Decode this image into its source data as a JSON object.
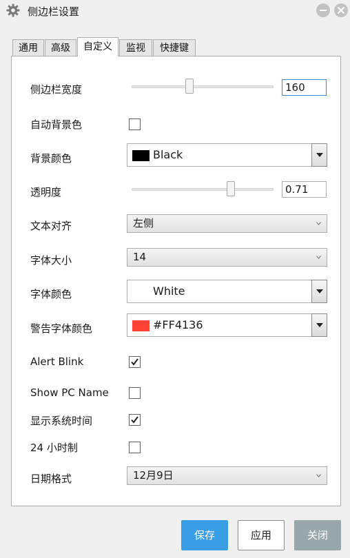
{
  "window": {
    "title": "侧边栏设置",
    "app_icon": "gear-icon",
    "minimize_icon": "minus-icon",
    "close_icon": "close-icon"
  },
  "tabs": [
    {
      "label": "通用",
      "active": false
    },
    {
      "label": "高级",
      "active": false
    },
    {
      "label": "自定义",
      "active": true
    },
    {
      "label": "监视",
      "active": false
    },
    {
      "label": "快捷键",
      "active": false
    }
  ],
  "settings": {
    "sidebar_width": {
      "label": "侧边栏宽度",
      "value": "160",
      "slider_fraction": 0.4
    },
    "auto_bg_color": {
      "label": "自动背景色",
      "checked": false
    },
    "bg_color": {
      "label": "背景颜色",
      "color_name": "Black",
      "swatch": "#000000"
    },
    "opacity": {
      "label": "透明度",
      "value": "0.71",
      "slider_fraction": 0.71
    },
    "text_align": {
      "label": "文本对齐",
      "value": "左侧"
    },
    "font_size": {
      "label": "字体大小",
      "value": "14"
    },
    "font_color": {
      "label": "字体颜色",
      "color_name": "White",
      "swatch": "#FFFFFF"
    },
    "alert_font_color": {
      "label": "警告字体颜色",
      "color_name": "#FF4136",
      "swatch": "#FF4136"
    },
    "alert_blink": {
      "label": "Alert Blink",
      "checked": true
    },
    "show_pc_name": {
      "label": "Show PC Name",
      "checked": false
    },
    "show_system_time": {
      "label": "显示系统时间",
      "checked": true
    },
    "hour24": {
      "label": "24 小时制",
      "checked": false
    },
    "date_format": {
      "label": "日期格式",
      "value": "12月9日"
    }
  },
  "buttons": {
    "save": "保存",
    "apply": "应用",
    "close": "关闭"
  },
  "colors": {
    "accent": "#3A9EE4",
    "close_button": "#97A7AB"
  }
}
